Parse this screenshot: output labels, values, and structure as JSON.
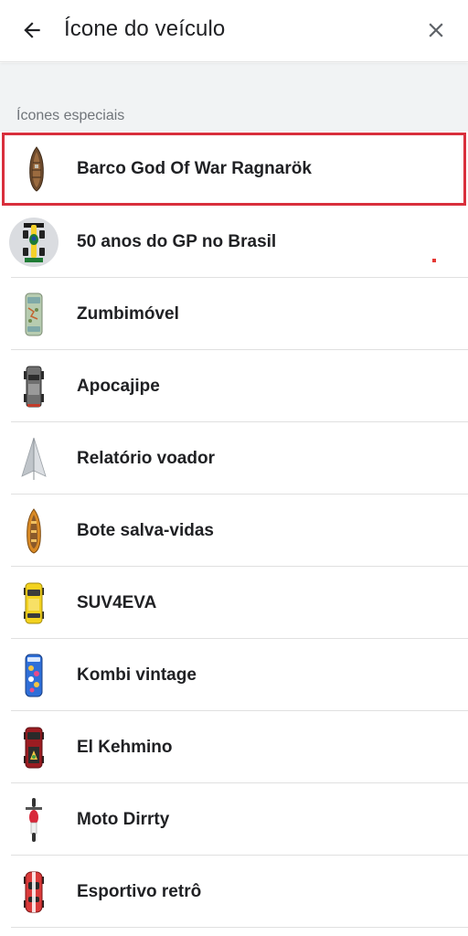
{
  "header": {
    "title": "Ícone do veículo",
    "back_icon": "arrow-back-icon",
    "close_icon": "close-icon"
  },
  "section": {
    "label": "Ícones especiais"
  },
  "colors": {
    "selection_border": "#d92f3c",
    "section_bg": "#f1f3f4"
  },
  "items": [
    {
      "label": "Barco God Of War Ragnarök",
      "icon": "viking-boat-icon",
      "selected": true
    },
    {
      "label": "50 anos do GP no Brasil",
      "icon": "formula-car-icon",
      "selected": false
    },
    {
      "label": "Zumbimóvel",
      "icon": "zombie-van-icon",
      "selected": false
    },
    {
      "label": "Apocajipe",
      "icon": "apocalypse-jeep-icon",
      "selected": false
    },
    {
      "label": "Relatório voador",
      "icon": "paper-plane-icon",
      "selected": false
    },
    {
      "label": "Bote salva-vidas",
      "icon": "lifeboat-icon",
      "selected": false
    },
    {
      "label": "SUV4EVA",
      "icon": "yellow-suv-icon",
      "selected": false
    },
    {
      "label": "Kombi vintage",
      "icon": "kombi-van-icon",
      "selected": false
    },
    {
      "label": "El Kehmino",
      "icon": "red-truck-icon",
      "selected": false
    },
    {
      "label": "Moto Dirrty",
      "icon": "motorcycle-icon",
      "selected": false
    },
    {
      "label": "Esportivo retrô",
      "icon": "retro-sports-car-icon",
      "selected": false
    }
  ]
}
